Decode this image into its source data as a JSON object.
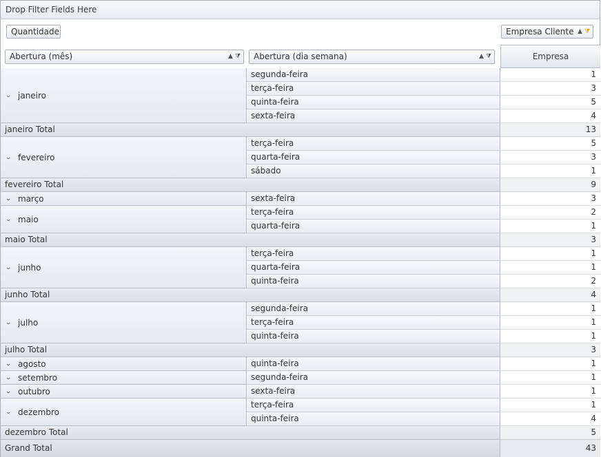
{
  "filter_area": {
    "label": "Drop Filter Fields Here"
  },
  "data_field": {
    "label": "Quantidade"
  },
  "column_field": {
    "label": "Empresa Cliente",
    "sort_icon": "sort-ascending-icon",
    "filter_icon": "filter-icon-active"
  },
  "row_fields": [
    {
      "label": "Abertura (mês)",
      "sort_icon": "sort-ascending-icon",
      "filter_icon": "filter-icon"
    },
    {
      "label": "Abertura (dia semana)",
      "sort_icon": "sort-ascending-icon",
      "filter_icon": "filter-icon"
    }
  ],
  "column_header": {
    "label": "Empresa"
  },
  "colors": {
    "accent_filter": "#e8a100",
    "border": "#b7bcc4",
    "header_bg": "#e6e9ee"
  },
  "groups": [
    {
      "month": "janeiro",
      "days": [
        {
          "day": "segunda-feira",
          "value": "1"
        },
        {
          "day": "terça-feira",
          "value": "3"
        },
        {
          "day": "quinta-feira",
          "value": "5"
        },
        {
          "day": "sexta-feira",
          "value": "4"
        }
      ],
      "total_label": "janeiro Total",
      "total_value": "13"
    },
    {
      "month": "fevereiro",
      "days": [
        {
          "day": "terça-feira",
          "value": "5"
        },
        {
          "day": "quarta-feira",
          "value": "3"
        },
        {
          "day": "sábado",
          "value": "1"
        }
      ],
      "total_label": "fevereiro Total",
      "total_value": "9"
    },
    {
      "month": "março",
      "days": [
        {
          "day": "sexta-feira",
          "value": "3"
        }
      ]
    },
    {
      "month": "maio",
      "days": [
        {
          "day": "terça-feira",
          "value": "2"
        },
        {
          "day": "quarta-feira",
          "value": "1"
        }
      ],
      "total_label": "maio Total",
      "total_value": "3"
    },
    {
      "month": "junho",
      "days": [
        {
          "day": "terça-feira",
          "value": "1"
        },
        {
          "day": "quarta-feira",
          "value": "1"
        },
        {
          "day": "quinta-feira",
          "value": "2"
        }
      ],
      "total_label": "junho Total",
      "total_value": "4"
    },
    {
      "month": "julho",
      "days": [
        {
          "day": "segunda-feira",
          "value": "1"
        },
        {
          "day": "terça-feira",
          "value": "1"
        },
        {
          "day": "quinta-feira",
          "value": "1"
        }
      ],
      "total_label": "julho Total",
      "total_value": "3"
    },
    {
      "month": "agosto",
      "days": [
        {
          "day": "quinta-feira",
          "value": "1"
        }
      ]
    },
    {
      "month": "setembro",
      "days": [
        {
          "day": "segunda-feira",
          "value": "1"
        }
      ]
    },
    {
      "month": "outubro",
      "days": [
        {
          "day": "sexta-feira",
          "value": "1"
        }
      ]
    },
    {
      "month": "dezembro",
      "days": [
        {
          "day": "terça-feira",
          "value": "1"
        },
        {
          "day": "quinta-feira",
          "value": "4"
        }
      ],
      "total_label": "dezembro Total",
      "total_value": "5"
    }
  ],
  "grand_total": {
    "label": "Grand Total",
    "value": "43"
  }
}
